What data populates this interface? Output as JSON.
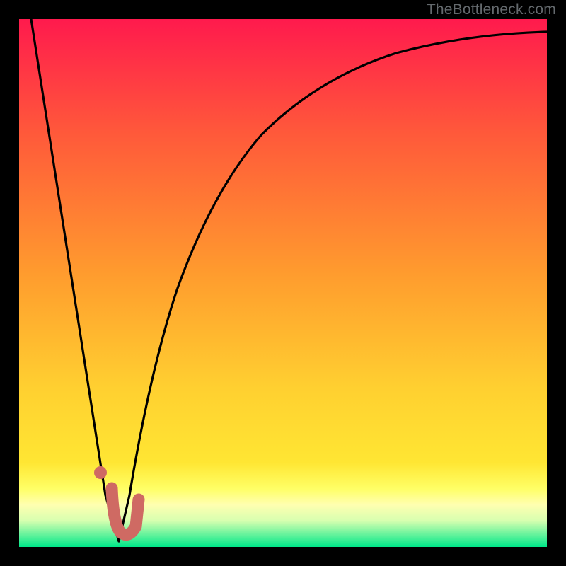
{
  "attribution": "TheBottleneck.com",
  "colors": {
    "gradient_top": "#ff1a4d",
    "gradient_mid1": "#ff7d2e",
    "gradient_mid2": "#ffe633",
    "gradient_band": "#ffffa0",
    "gradient_bottom": "#00e88a",
    "curve_stroke": "#000000",
    "marker_stroke": "#cf6a63",
    "background": "#000000"
  },
  "chart_data": {
    "type": "line",
    "title": "",
    "xlabel": "",
    "ylabel": "",
    "xlim": [
      0,
      100
    ],
    "ylim": [
      0,
      100
    ],
    "series": [
      {
        "name": "left-descent",
        "x": [
          2,
          16,
          18
        ],
        "values": [
          100,
          7,
          0
        ]
      },
      {
        "name": "right-ascent",
        "x": [
          18,
          20,
          23,
          27,
          32,
          38,
          45,
          55,
          70,
          85,
          100
        ],
        "values": [
          0,
          10,
          28,
          46,
          60,
          70,
          78,
          84,
          89,
          92,
          93
        ]
      }
    ],
    "markers": [
      {
        "name": "dot",
        "x": 14.5,
        "y": 13
      },
      {
        "name": "hook",
        "x_range": [
          17,
          21
        ],
        "y_range": [
          0,
          10
        ]
      }
    ]
  }
}
